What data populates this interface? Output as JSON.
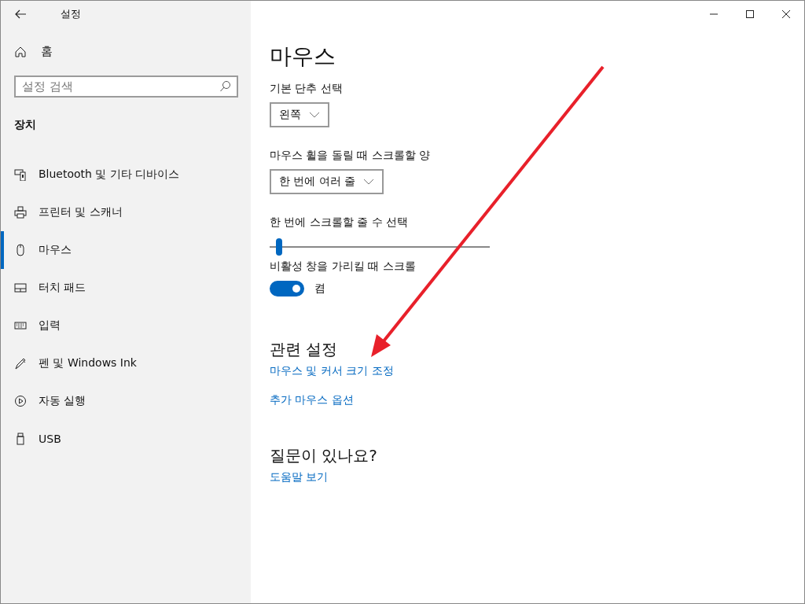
{
  "window": {
    "title": "설정"
  },
  "sidebar": {
    "home": "홈",
    "search": {
      "placeholder": "설정 검색"
    },
    "section": "장치",
    "items": [
      {
        "label": "Bluetooth 및 기타 디바이스",
        "selected": false
      },
      {
        "label": "프린터 및 스캐너",
        "selected": false
      },
      {
        "label": "마우스",
        "selected": true
      },
      {
        "label": "터치 패드",
        "selected": false
      },
      {
        "label": "입력",
        "selected": false
      },
      {
        "label": "펜 및 Windows Ink",
        "selected": false
      },
      {
        "label": "자동 실행",
        "selected": false
      },
      {
        "label": "USB",
        "selected": false
      }
    ]
  },
  "content": {
    "title": "마우스",
    "primary_button": {
      "label": "기본 단추 선택",
      "value": "왼쪽"
    },
    "wheel_scroll": {
      "label": "마우스 휠을 돌릴 때 스크롤할 양",
      "value": "한 번에 여러 줄"
    },
    "lines_slider": {
      "label": "한 번에 스크롤할 줄 수 선택",
      "level": 0.03
    },
    "inactive_scroll": {
      "label": "비활성 창을 가리킬 때 스크롤",
      "on": true,
      "state_text": "켬"
    },
    "related": {
      "heading": "관련 설정",
      "links": [
        "마우스 및 커서 크기 조정",
        "추가 마우스 옵션"
      ]
    },
    "help": {
      "heading": "질문이 있나요?",
      "links": [
        "도움말 보기"
      ]
    }
  }
}
